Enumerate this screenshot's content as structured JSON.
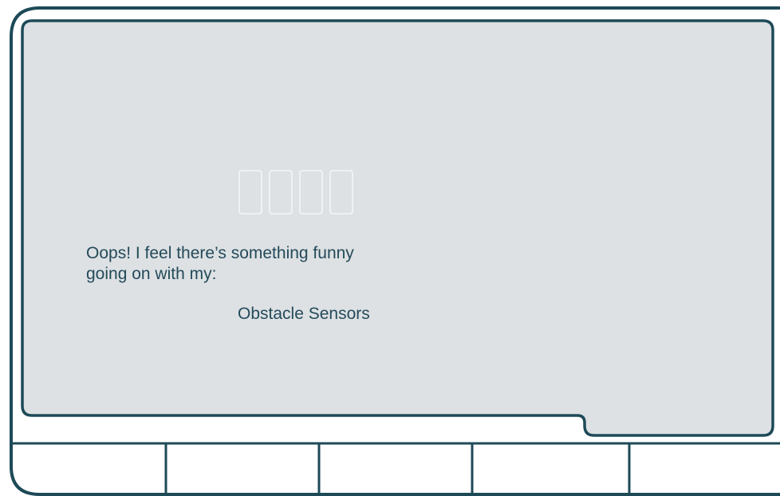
{
  "message": {
    "line1": "Oops! I feel there’s something funny",
    "line2": "going on with my:",
    "error_item": "Obstacle Sensors"
  },
  "status_icon": "robot-face-dots-icon",
  "softkeys": [
    "",
    "",
    "",
    "",
    ""
  ],
  "colors": {
    "outline": "#1e4a58",
    "screen_bg": "#dde1e3",
    "text": "#244a5a",
    "device_bg": "#ffffff"
  }
}
